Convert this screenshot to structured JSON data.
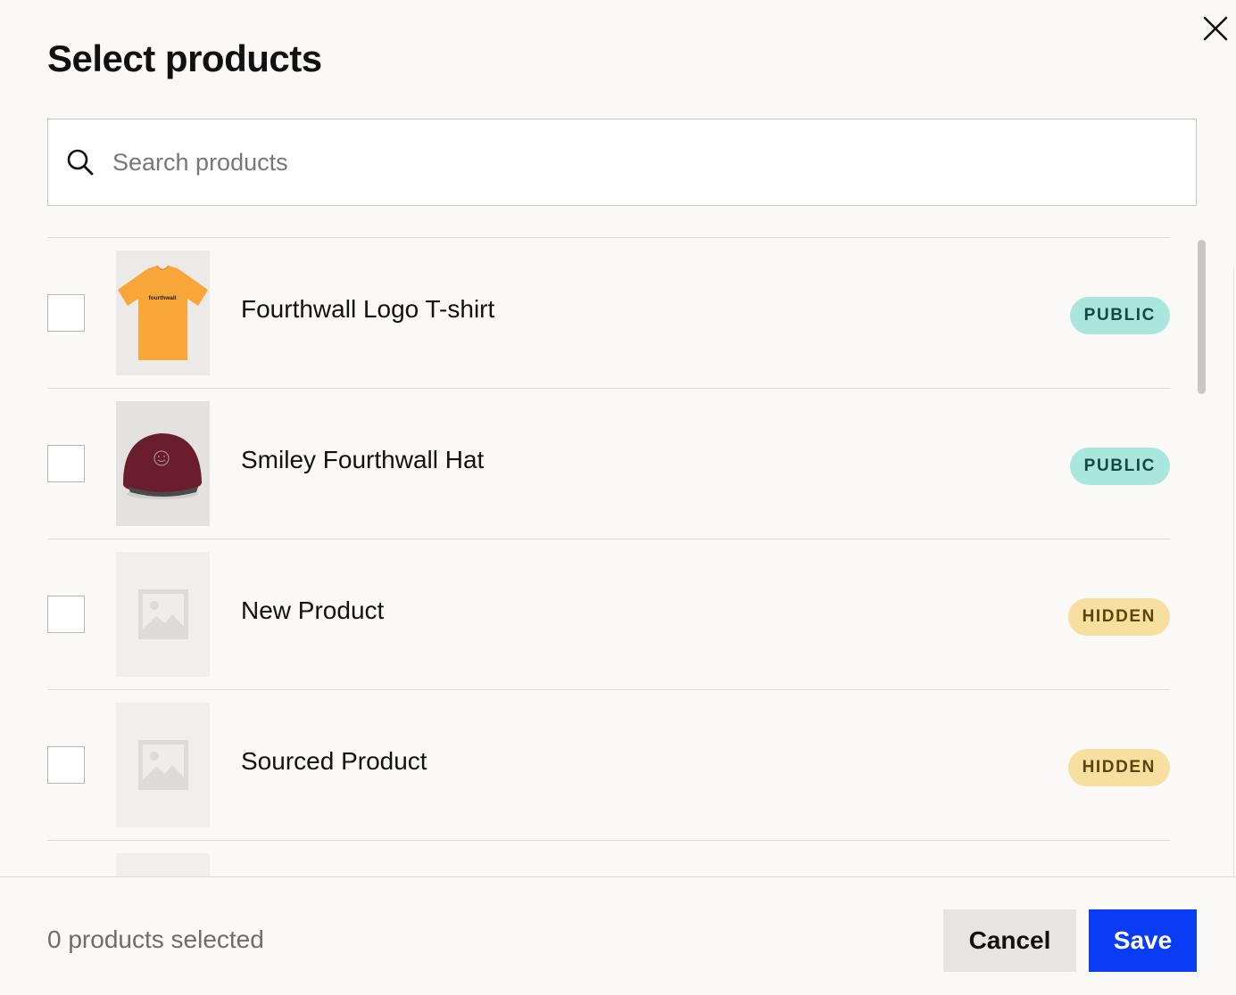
{
  "dialog": {
    "title": "Select products",
    "close_icon": "close-icon"
  },
  "search": {
    "icon": "search-icon",
    "placeholder": "Search products",
    "value": ""
  },
  "products": [
    {
      "name": "Fourthwall Logo T-shirt",
      "status": "PUBLIC",
      "thumbnail": "tshirt",
      "thumb_text": "fourthwall",
      "checked": false
    },
    {
      "name": "Smiley Fourthwall Hat",
      "status": "PUBLIC",
      "thumbnail": "hat",
      "checked": false
    },
    {
      "name": "New Product",
      "status": "HIDDEN",
      "thumbnail": "placeholder",
      "checked": false
    },
    {
      "name": "Sourced Product",
      "status": "HIDDEN",
      "thumbnail": "placeholder",
      "checked": false
    },
    {
      "name": "",
      "status": "",
      "thumbnail": "placeholder",
      "checked": false
    }
  ],
  "footer": {
    "selected_count": "0 products selected",
    "cancel_label": "Cancel",
    "save_label": "Save"
  },
  "colors": {
    "public_badge_bg": "#a9e7dc",
    "hidden_badge_bg": "#f7dfa0",
    "save_button_bg": "#0a3cf5",
    "cancel_button_bg": "#e6e5e3"
  }
}
